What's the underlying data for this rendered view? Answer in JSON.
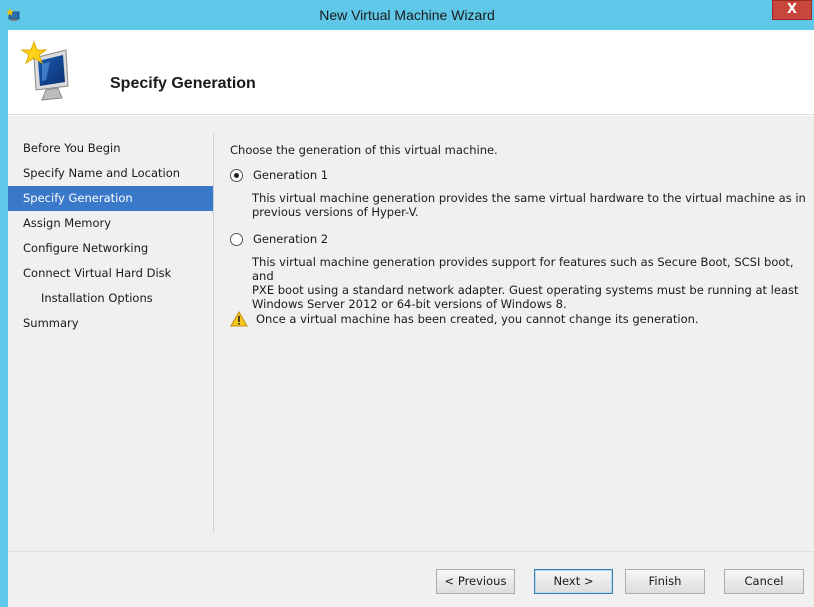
{
  "window": {
    "title": "New Virtual Machine Wizard",
    "close_glyph": "X"
  },
  "header": {
    "title": "Specify Generation",
    "icon": "monitor-star-icon"
  },
  "steps": [
    {
      "label": "Before You Begin",
      "active": false
    },
    {
      "label": "Specify Name and Location",
      "active": false
    },
    {
      "label": "Specify Generation",
      "active": true
    },
    {
      "label": "Assign Memory",
      "active": false
    },
    {
      "label": "Configure Networking",
      "active": false
    },
    {
      "label": "Connect Virtual Hard Disk",
      "active": false
    },
    {
      "label": "Installation Options",
      "active": false
    },
    {
      "label": "Summary",
      "active": false
    }
  ],
  "content": {
    "prompt": "Choose the generation of this virtual machine.",
    "gen1": {
      "label": "Generation 1",
      "selected": true,
      "desc_line1": "This virtual machine generation provides the same virtual hardware to the virtual machine as in",
      "desc_line2": "previous versions of Hyper-V."
    },
    "gen2": {
      "label": "Generation 2",
      "selected": false,
      "desc_line1": "This virtual machine generation provides support for features such as Secure Boot, SCSI boot, and",
      "desc_line2": "PXE boot using a standard network adapter. Guest operating systems must be running at least",
      "desc_line3": "Windows Server 2012 or 64-bit versions of Windows 8."
    },
    "warning": "Once a virtual machine has been created, you cannot change its generation."
  },
  "buttons": {
    "previous": "< Previous",
    "next": "Next >",
    "finish": "Finish",
    "cancel": "Cancel"
  },
  "colors": {
    "titlebar": "#5fc8e8",
    "selection": "#3a78c9",
    "close": "#c9463d"
  }
}
